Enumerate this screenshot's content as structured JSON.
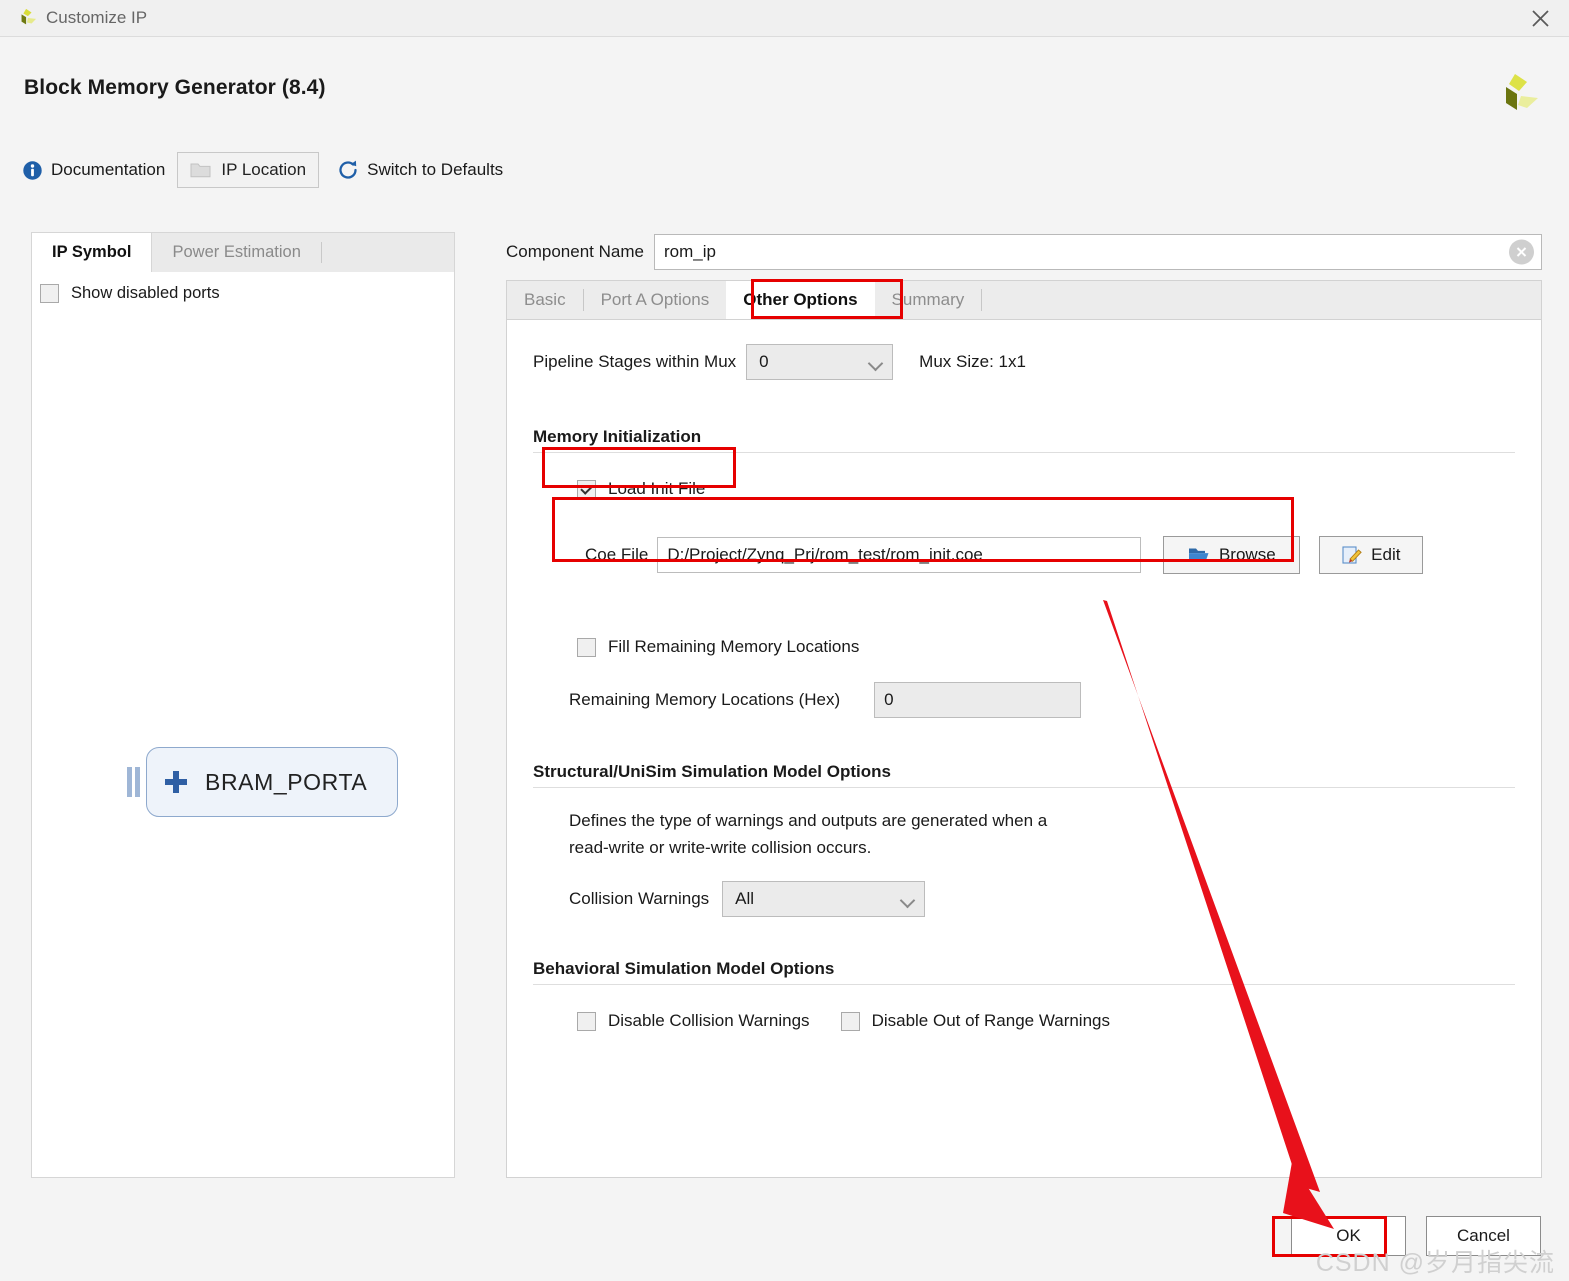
{
  "window": {
    "title": "Customize IP",
    "close_icon": "close-icon",
    "logo_icon": "xilinx-logo-icon"
  },
  "header": {
    "title": "Block Memory Generator (8.4)",
    "brand_logo_icon": "xilinx-logo-icon"
  },
  "toolbar": {
    "documentation": {
      "label": "Documentation",
      "icon": "info-icon"
    },
    "ip_location": {
      "label": "IP Location",
      "icon": "folder-icon"
    },
    "switch_to_defaults": {
      "label": "Switch to Defaults",
      "icon": "refresh-icon"
    }
  },
  "left_panel": {
    "tabs": [
      {
        "label": "IP Symbol",
        "active": true
      },
      {
        "label": "Power Estimation",
        "active": false
      }
    ],
    "show_disabled_ports": {
      "label": "Show disabled ports",
      "checked": false
    },
    "symbol": {
      "label": "BRAM_PORTA",
      "expand_icon": "plus-icon"
    }
  },
  "component_name": {
    "label": "Component Name",
    "value": "rom_ip",
    "clear_icon": "clear-circle-icon"
  },
  "tabs": [
    {
      "label": "Basic",
      "active": false
    },
    {
      "label": "Port A Options",
      "active": false
    },
    {
      "label": "Other Options",
      "active": true
    },
    {
      "label": "Summary",
      "active": false
    }
  ],
  "other_options": {
    "pipeline": {
      "label": "Pipeline Stages within Mux",
      "value": "0",
      "mux_size": "Mux Size: 1x1"
    },
    "memory_initialization": {
      "title": "Memory Initialization",
      "load_init_file": {
        "label": "Load Init File",
        "checked": true
      },
      "coe_file": {
        "label": "Coe File",
        "value": "D:/Project/Zynq_Prj/rom_test/rom_init.coe",
        "browse_label": "Browse",
        "browse_icon": "folder-open-icon",
        "edit_label": "Edit",
        "edit_icon": "edit-pencil-icon"
      },
      "fill_remaining": {
        "label": "Fill Remaining Memory Locations",
        "checked": false
      },
      "remaining_hex": {
        "label": "Remaining Memory Locations (Hex)",
        "value": "0"
      }
    },
    "structural": {
      "title": "Structural/UniSim Simulation Model Options",
      "description_line1": "Defines the type of warnings and outputs are generated when a",
      "description_line2": "read-write or write-write collision occurs.",
      "collision_warnings": {
        "label": "Collision Warnings",
        "value": "All"
      }
    },
    "behavioral": {
      "title": "Behavioral Simulation Model Options",
      "disable_collision": {
        "label": "Disable Collision Warnings",
        "checked": false
      },
      "disable_out_of_range": {
        "label": "Disable Out of Range Warnings",
        "checked": false
      }
    }
  },
  "footer": {
    "ok_label": "OK",
    "cancel_label": "Cancel"
  },
  "annotations": {
    "highlight_color": "#e60000",
    "arrow_color": "#e8111b",
    "watermark": "CSDN @岁月指尖流"
  }
}
